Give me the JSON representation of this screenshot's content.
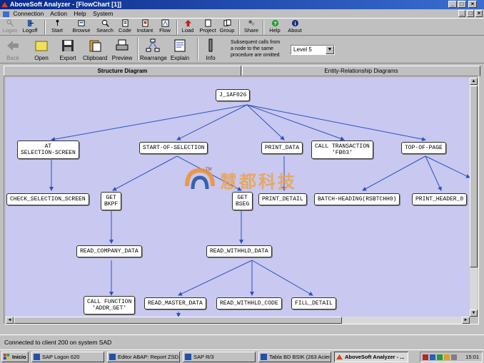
{
  "window": {
    "title": "AboveSoft Analyzer - [FlowChart [1]]"
  },
  "menu": [
    "Connection",
    "Action",
    "Help",
    "System"
  ],
  "toolbar1": [
    {
      "label": "Logon",
      "icon": "key-icon",
      "disabled": true
    },
    {
      "label": "Logoff",
      "icon": "exit-icon"
    },
    {
      "label": "Start",
      "icon": "start-icon"
    },
    {
      "label": "Browse",
      "icon": "browse-icon"
    },
    {
      "label": "Search",
      "icon": "search-icon"
    },
    {
      "label": "Code",
      "icon": "code-icon"
    },
    {
      "label": "Instant",
      "icon": "instant-icon"
    },
    {
      "label": "Flow",
      "icon": "flow-icon"
    },
    {
      "label": "Load",
      "icon": "load-icon"
    },
    {
      "label": "Project",
      "icon": "project-icon"
    },
    {
      "label": "Group",
      "icon": "group-icon"
    },
    {
      "label": "Share",
      "icon": "share-icon"
    },
    {
      "label": "Help",
      "icon": "help-icon"
    },
    {
      "label": "About",
      "icon": "info-icon"
    }
  ],
  "toolbar2": [
    {
      "label": "Back",
      "icon": "back-arrow-icon",
      "disabled": true
    },
    {
      "label": "Open",
      "icon": "folder-icon"
    },
    {
      "label": "Export",
      "icon": "floppy-icon"
    },
    {
      "label": "Clipboard",
      "icon": "clipboard-icon"
    },
    {
      "label": "Preview",
      "icon": "printer-icon"
    },
    {
      "label": "Rearrange",
      "icon": "rearrange-icon"
    },
    {
      "label": "Explain",
      "icon": "explain-icon"
    },
    {
      "label": "Info",
      "icon": "info-pin-icon"
    }
  ],
  "note": "Subsequent calls from a node to the same procedure are omitted",
  "level_select": {
    "value": "Level 5"
  },
  "tabs": [
    {
      "label": "Structure Diagram",
      "active": true
    },
    {
      "label": "Entity-Relationship Diagrams",
      "active": false
    }
  ],
  "nodes": {
    "root": "J_1AF026",
    "at_sel": "AT\nSELECTION-SCREEN",
    "start_sel": "START-OF-SELECTION",
    "print_data": "PRINT_DATA",
    "call_tx": "CALL TRANSACTION\n'FB03'",
    "top_page": "TOP-OF-PAGE",
    "check_sel": "CHECK_SELECTION_SCREEN",
    "get_bkpf": "GET\nBKPF",
    "get_bseg": "GET\nBSEG",
    "print_detail": "PRINT_DETAIL",
    "batch_heading": "BATCH-HEADING(RSBTCHH0)",
    "print_header": "PRINT_HEADER_0",
    "read_company": "READ_COMPANY_DATA",
    "read_withhld": "READ_WITHHLD_DATA",
    "call_func": "CALL FUNCTION\n'ADDR_GET'",
    "read_master": "READ_MASTER_DATA",
    "read_withhld_code": "READ_WITHHLD_CODE",
    "fill_detail": "FILL_DETAIL"
  },
  "watermark": {
    "text": "慧都科技",
    "tm": "TM"
  },
  "status": "Connected to client 200 on system SAD",
  "taskbar": {
    "start": "Inicio",
    "tasks": [
      {
        "label": "SAP Logon 620",
        "active": false
      },
      {
        "label": "Editor ABAP: Report ZSD...",
        "active": false
      },
      {
        "label": "SAP R/3",
        "active": false
      },
      {
        "label": "Tabla BD BSIK (263 Acier...",
        "active": false
      },
      {
        "label": "AboveSoft Analyzer - ...",
        "active": true
      }
    ],
    "clock": "15:01"
  },
  "colors": {
    "canvas": "#c8c8f0",
    "line": "#3050c0",
    "title": "#0a2a8a"
  }
}
